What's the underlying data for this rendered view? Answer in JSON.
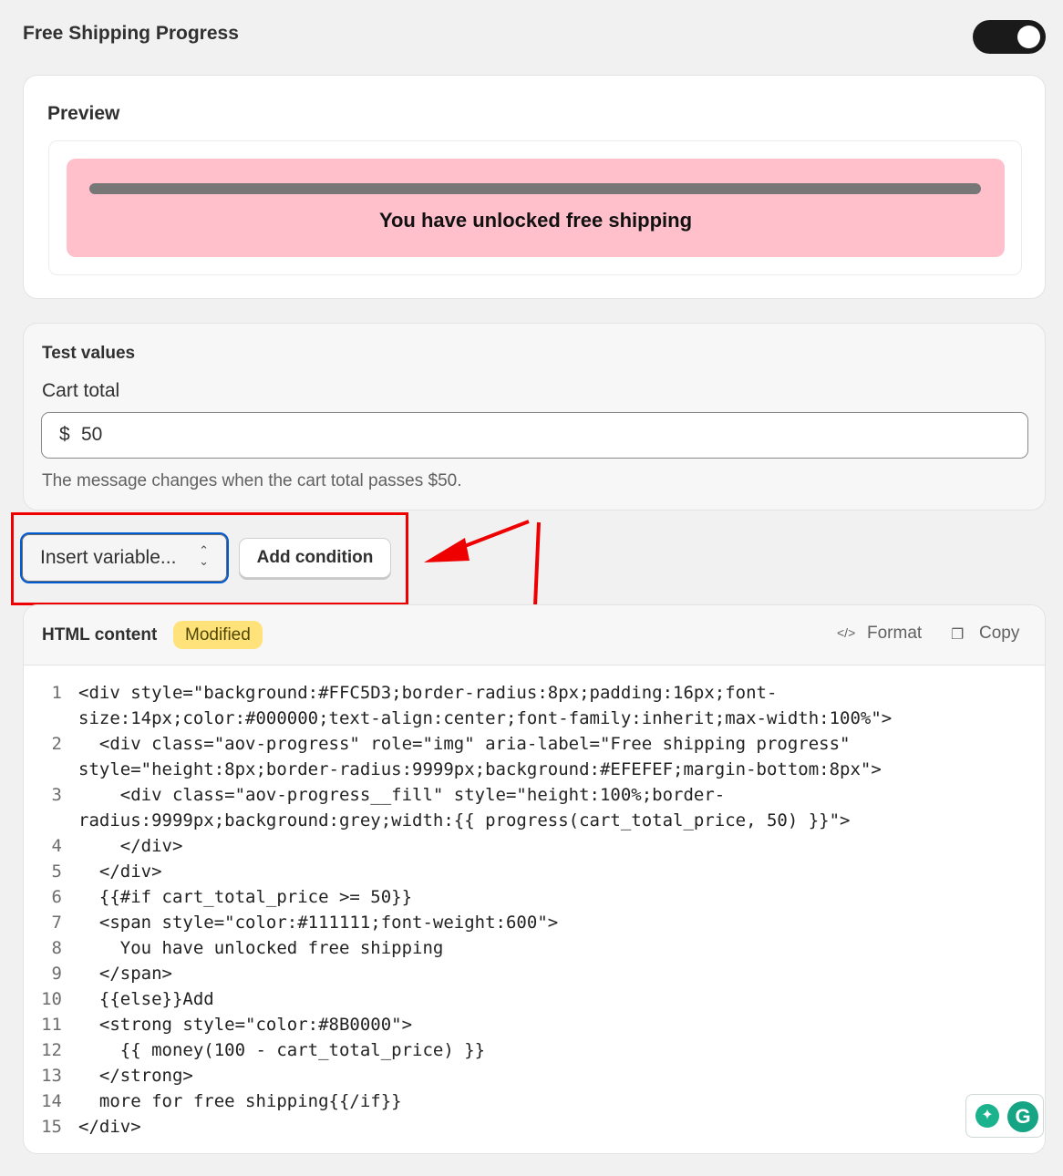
{
  "header": {
    "title": "Free Shipping Progress",
    "toggle_on": true
  },
  "preview": {
    "heading": "Preview",
    "banner_color": "#FFC0CC",
    "progress_fill_fraction": 1.0,
    "message": "You have unlocked free shipping"
  },
  "test_values": {
    "heading": "Test values",
    "cart_total_label": "Cart total",
    "currency_prefix": "$",
    "cart_total_value": "50",
    "help_text": "The message changes when the cart total passes $50."
  },
  "toolbar": {
    "insert_variable_label": "Insert variable...",
    "add_condition_label": "Add condition"
  },
  "code_editor": {
    "title": "HTML content",
    "badge": "Modified",
    "format_label": "Format",
    "copy_label": "Copy",
    "format_icon": "code-icon",
    "copy_icon": "clipboard-icon",
    "line_numbers": [
      "1",
      "2",
      "3",
      "4",
      "5",
      "6",
      "7",
      "8",
      "9",
      "10",
      "11",
      "12",
      "13",
      "14",
      "15"
    ],
    "lines": [
      "<div style=\"background:#FFC5D3;border-radius:8px;padding:16px;font-",
      "size:14px;color:#000000;text-align:center;font-family:inherit;max-width:100%\">",
      "  <div class=\"aov-progress\" role=\"img\" aria-label=\"Free shipping progress\"",
      "style=\"height:8px;border-radius:9999px;background:#EFEFEF;margin-bottom:8px\">",
      "    <div class=\"aov-progress__fill\" style=\"height:100%;border-",
      "radius:9999px;background:grey;width:{{ progress(cart_total_price, 50) }}\">",
      "    </div>",
      "  </div>",
      "  {{#if cart_total_price >= 50}}",
      "  <span style=\"color:#111111;font-weight:600\">",
      "    You have unlocked free shipping",
      "  </span>",
      "  {{else}}Add",
      "  <strong style=\"color:#8B0000\">",
      "    {{ money(100 - cart_total_price) }}",
      "  </strong>",
      "  more for free shipping{{/if}}",
      "</div>"
    ]
  },
  "annotations": {
    "highlight_color": "#EE0000"
  },
  "grammarly": {
    "bulb_icon": "lightbulb-icon",
    "logo_letter": "G"
  }
}
